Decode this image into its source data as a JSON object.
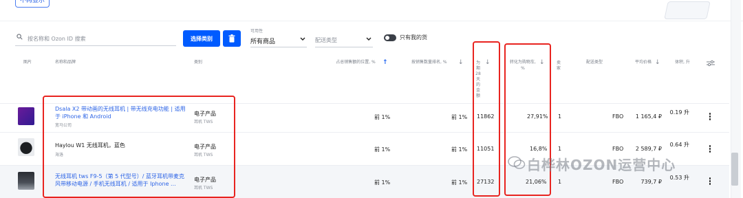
{
  "top": {
    "button_label": "不再显示"
  },
  "filters": {
    "search_placeholder": "按名称和 Ozon ID 搜索",
    "select_category_btn": "选择类别",
    "availability_label": "可用性",
    "availability_value": "所有商品",
    "delivery_placeholder": "配送类型",
    "only_mine_label": "只有我的货"
  },
  "columns": {
    "image": "图片",
    "name_brand": "名称和品牌",
    "category": "类别",
    "share_pct": "占总销售额的位置, %",
    "sales_rank": "按销售数量排名, %",
    "orders_28": "为期28天的金额",
    "conversion": "转化为购物车, %",
    "sellers": "卖家",
    "delivery": "配送类型",
    "avg_price": "平均价格",
    "volume": "体积, 升"
  },
  "rows": [
    {
      "name": "Dsala X2 带动画的无线耳机 | 带无线充电功能 | 适用于 iPhone 和 Android",
      "brand": "宽马公司",
      "category": "电子产品",
      "subcategory": "耳机 TWS",
      "share": "前 1%",
      "rank": "前 1%",
      "orders": "11862",
      "conversion": "27,91%",
      "sellers": "1",
      "delivery": "FBO",
      "price": "1 165,4 ₽",
      "volume": "0.19 升"
    },
    {
      "name": "Haylou W1 无线耳机，蓝色",
      "brand": "海洛",
      "category": "电子产品",
      "subcategory": "耳机 TWS",
      "share": "前 1%",
      "rank": "前 1%",
      "orders": "11051",
      "conversion": "16,8%",
      "sellers": "1",
      "delivery": "FBO",
      "price": "2 589,7 ₽",
      "volume": "0.64 升"
    },
    {
      "name": "无线耳机 tws F9-5（第 5 代型号）/ 蓝牙耳机带麦克风带移动电源 / 手机无线耳机 / 适用于 Iphone ...",
      "brand": "",
      "category": "电子产品",
      "subcategory": "耳机 TWS",
      "share": "前 1%",
      "rank": "前 1%",
      "orders": "27132",
      "conversion": "21,06%",
      "sellers": "1",
      "delivery": "FBO",
      "price": "739,7 ₽",
      "volume": "0.53 升"
    }
  ],
  "watermark": "白桦林OZON运营中心",
  "colors": {
    "accent": "#005bff",
    "link": "#2b63e6",
    "highlight": "#e8231f"
  }
}
